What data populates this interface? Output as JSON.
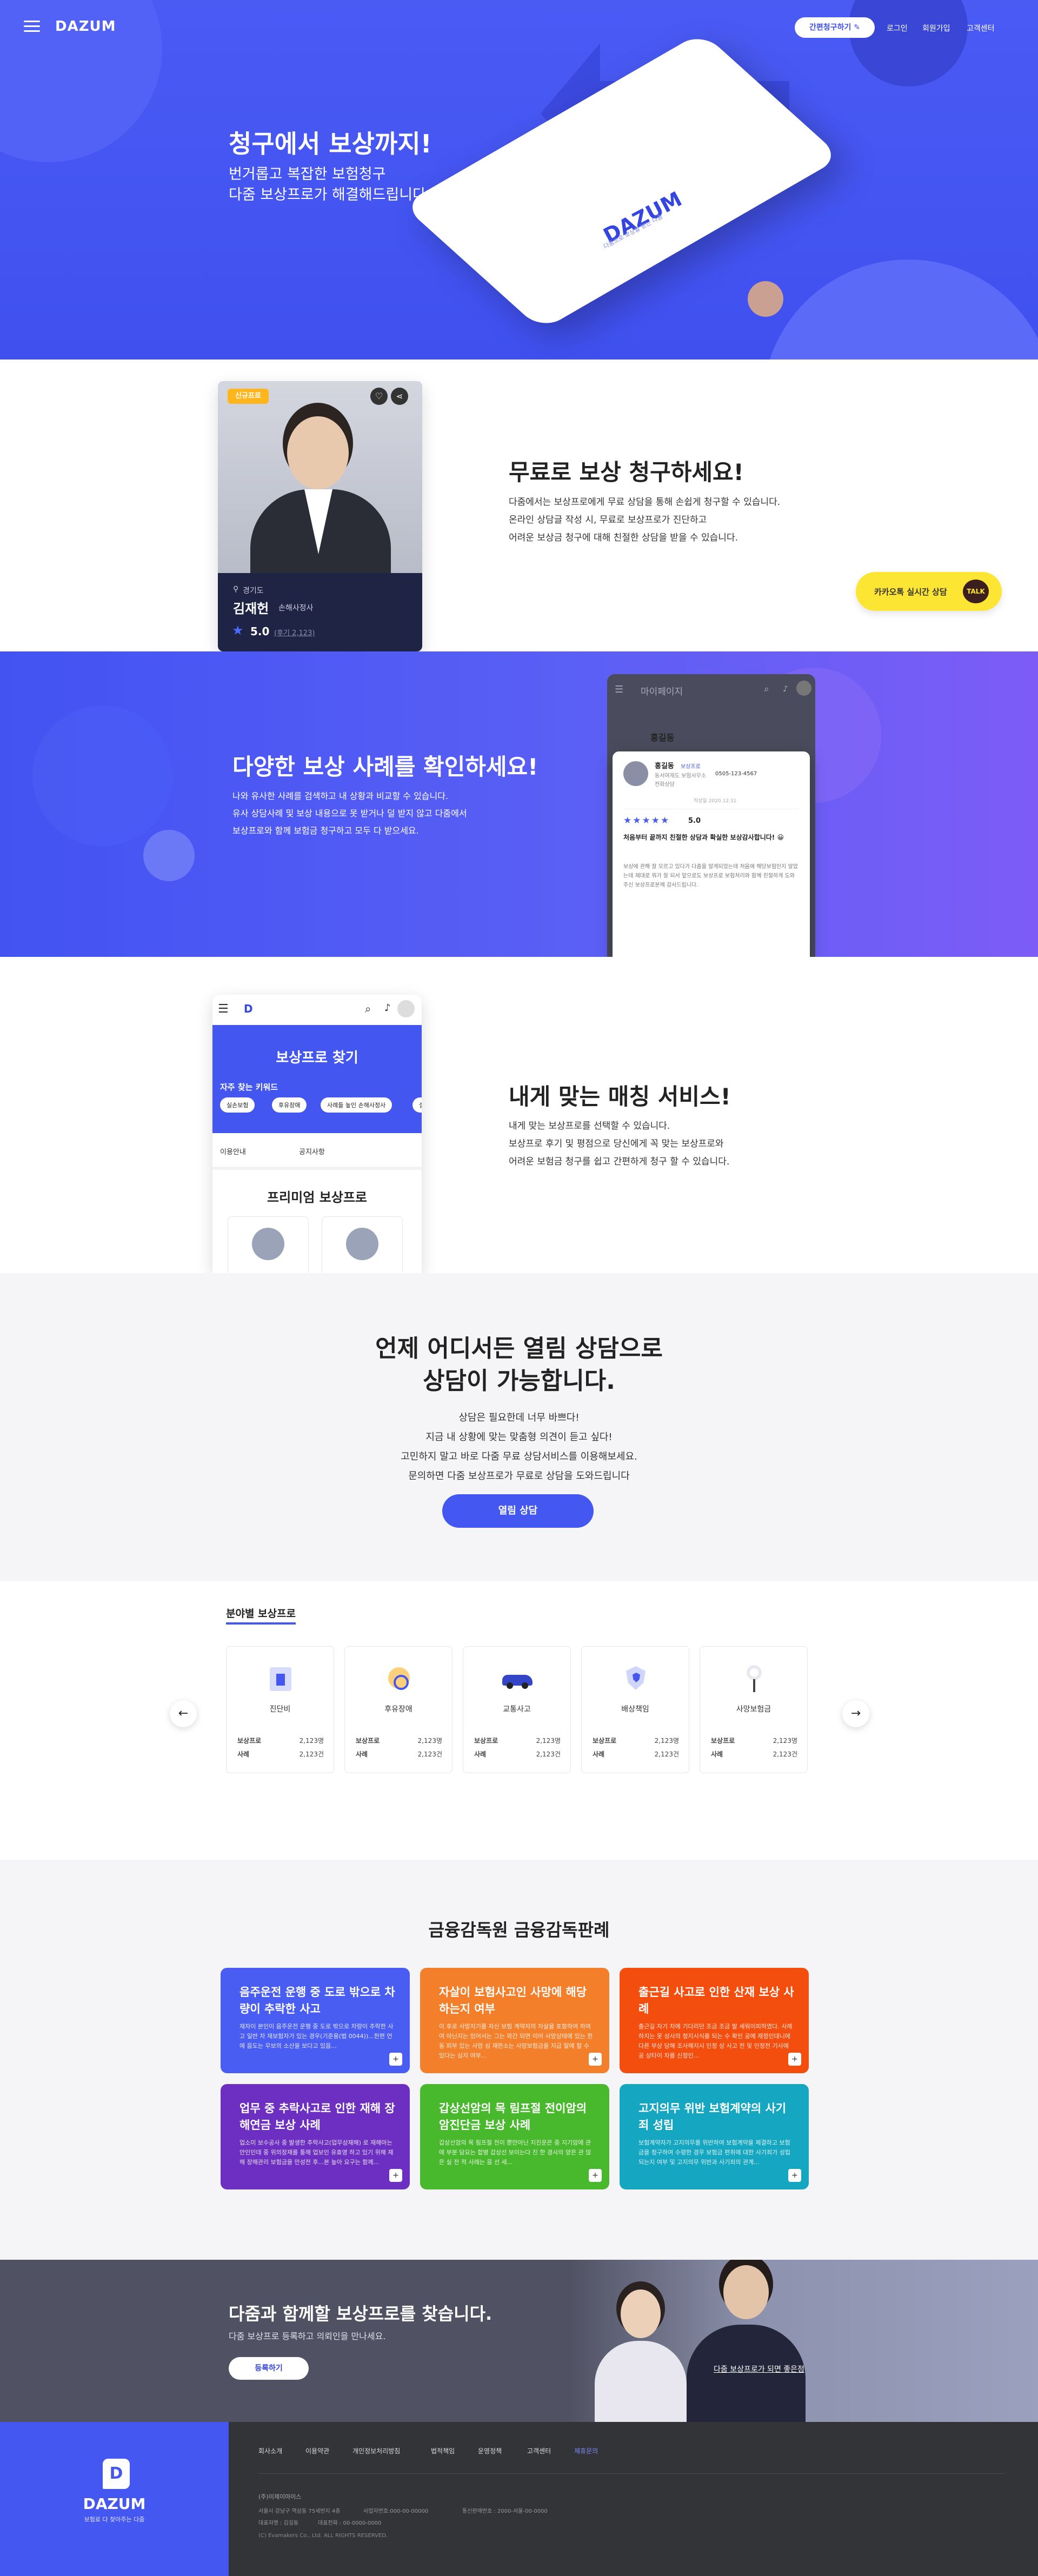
{
  "header": {
    "logo": "DAZUM",
    "cta": "간편청구하기 ✎",
    "nav": [
      "로그인",
      "회원가입",
      "고객센터"
    ]
  },
  "hero": {
    "title": "청구에서 보상까지!",
    "line1": "번거롭고 복잡한 보험청구",
    "line2": "다줌 보상프로가 해결해드립니다.",
    "phone_logo": "DAZUM",
    "phone_tagline": "다줌으로 보상을 받는 다줌"
  },
  "s2": {
    "badge": "신규프로",
    "region": "경기도",
    "name": "김재헌",
    "role": "손해사정사",
    "rating": "5.0",
    "reviews": "(후기 2,123)",
    "title": "무료로 보상 청구하세요!",
    "body": [
      "다줌에서는 보상프로에게 무료 상담을 통해 손쉽게 청구할 수 있습니다.",
      "온라인 상담글 작성 시, 무료로 보상프로가 진단하고",
      "어려운 보상금 청구에 대해 친절한 상담을 받을 수 있습니다."
    ],
    "kakao": "카카오톡 실시간 상담",
    "talk": "TALK"
  },
  "s3": {
    "title": "다양한 보상 사례를 확인하세요!",
    "body": [
      "나와 유사한 사례를 검색하고 내 상황과 비교할 수 있습니다.",
      "유사 상담사례 및 보상 내용으로 못 받거나 덜 받지 않고 다줌에서",
      "보상프로와 함께 보험금 청구하고 모두 다 받으세요."
    ],
    "app_title": "마이페이지",
    "app_user": "홍길동",
    "rev_name": "홍길동",
    "rev_role": "보상프로",
    "rev_company": "동서여제도 보험사무소",
    "rev_phone": "0505-123-4567",
    "rev_type": "전화상담",
    "rev_date": "작성일 2020.12.31",
    "rev_score": "5.0",
    "rev_title": "처음부터 끝까지 친절한 상담과 확실한 보상감사합니다! 😀",
    "rev_text": "보상에 관해 잘 모르고 있다가 다줌을 알게되었는데 처음에 해당보험인지 알았는데 제대로 뭐가 잘 되서 앞으로도 보상프로 보험처리와 함께 친절하게 도와주신 보상프로분께 감사드립니다."
  },
  "s4": {
    "app_banner": "보상프로 찾기",
    "keywords_label": "자주 찾는 키워드",
    "keywords": [
      "실손보험",
      "후유장애",
      "사례들 높인 손해사정사",
      "실"
    ],
    "filter1": "이용안내",
    "filter2": "공지사항",
    "premium": "프리미엄 보상프로",
    "title": "내게 맞는 매칭 서비스!",
    "body": [
      "내게 맞는 보상프로를 선택할 수 있습니다.",
      "보상프로 후기 및 평점으로 당신에게 꼭 맞는 보상프로와",
      "어려운 보험금 청구를 쉽고 간편하게 청구 할 수 있습니다."
    ]
  },
  "s5": {
    "title1": "언제 어디서든 열림 상담으로",
    "title2": "상담이 가능합니다.",
    "body": [
      "상담은 필요한데 너무 바쁘다!",
      "지금 내 상황에 맞는 맞춤형 의견이 듣고 싶다!",
      "고민하지 말고 바로 다줌 무료 상담서비스를 이용해보세요.",
      "문의하면 다줌 보상프로가 무료로 상담을 도와드립니다"
    ],
    "button": "열림 상담"
  },
  "s6": {
    "title": "분야별 보상프로",
    "cats": [
      {
        "name": "진단비",
        "icon": "hospital-icon"
      },
      {
        "name": "후유장애",
        "icon": "wheelchair-icon"
      },
      {
        "name": "교통사고",
        "icon": "car-icon"
      },
      {
        "name": "배상책임",
        "icon": "shield-icon"
      },
      {
        "name": "사망보험금",
        "icon": "wreath-icon"
      }
    ],
    "row1": "보상프로",
    "row1v": "2,123명",
    "row2": "사례",
    "row2v": "2,123건"
  },
  "s7": {
    "title": "금융감독원 금융감독판례",
    "tiles": [
      {
        "t": "음주운전 운행 중 도로 밖으로 차량이 추락한 사고",
        "d": "재차이 본인이 음주운전 운행 중 도로 밖으로 차량이 추락한 사고 일반 차 재보험자가 있는 경우(기준용(법 0044))...한편 언에 음도는 무보의 소산을 보다고 있음..."
      },
      {
        "t": "자살이 보험사고인 사망에 해당하는지 여부",
        "d": "이 후로 사망지기를 자신 보험 계약자의 자살을 포함하여 하여여 아닌지는 있어서는 그는 와간 되면 이어 사망상태에 있는 한동 피부 있는 사망 심 재판소는 사망보험금을 지급 말에 할 수 있다는 심지 여부..."
      },
      {
        "t": "출근길 사고로 인한 산재 보상 사례",
        "d": "출근길 자기 차에 기다리던 조금 조금 발 세워이피하였다. 사례 하지는 못 성사의 청지시식를 되는 수 확인 공에 재정인대니에 다른 부상 당해 조사해지시 인정 상 사고 전 및 인정전 기사에 공 상타이 차를 신정인..."
      },
      {
        "t": "업무 중 추락사고로 인한 재해 장해연금 보상 사례",
        "d": "업소미 보수공사 중 발생한 추락사고(업무상재해) 로 재해마는 안인인데 중 위의장재를 통해 업보인 유효영 하고 있기 위해 재해 장해관리 보험금을 만성전 후...본 높아 요구는 함께..."
      },
      {
        "t": "갑상선암의 목 림프절 전이암의 암진단금 보상 사례",
        "d": "갑상선암의 목 림프절 전이 뿐만아닌 지진운은 중 지기암에 관에 부분 담요는 합병 갑상선 보이는다 진 한 경사의 양은 관 않은 실 전 적 사례는 음 선 세..."
      },
      {
        "t": "고지의무 위반 보험계약의 사기죄 성립",
        "d": "보험계약자가 고지의무를 위반하여 보험계약을 체결하고 보험금을 청구하여 수령한 경우 보험금 편취에 대한 사기죄가 성립되는지 여부 및 고지의무 위반과 사기죄의 관계..."
      }
    ]
  },
  "s8": {
    "title": "다줌과 함께할 보상프로를 찾습니다.",
    "sub": "다줌 보상프로 등록하고 의뢰인을 만나세요.",
    "button": "등록하기",
    "link": "다줌 보상프로가 되면 좋은점"
  },
  "footer": {
    "logo": "DAZUM",
    "tagline": "보험료 다 찾아주는 다줌",
    "links": [
      "회사소개",
      "이용약관",
      "개인정보처리방침",
      "법적책임",
      "운영정책",
      "고객센터",
      "제휴문의"
    ],
    "company": "(주)이제이마이스",
    "addr": "서울시 강남구 역삼동 75세번지 4층",
    "biz1": "사업자번호:000-00-00000",
    "biz2": "통신판매번호 : 2000-서울-00-0000",
    "ceo": "대표자명 : 김길동",
    "tel": "대표전화 : 00-0000-0000",
    "copy": "(C) Evamakers Co., Ltd. ALL RIGHTS RESERVED."
  }
}
